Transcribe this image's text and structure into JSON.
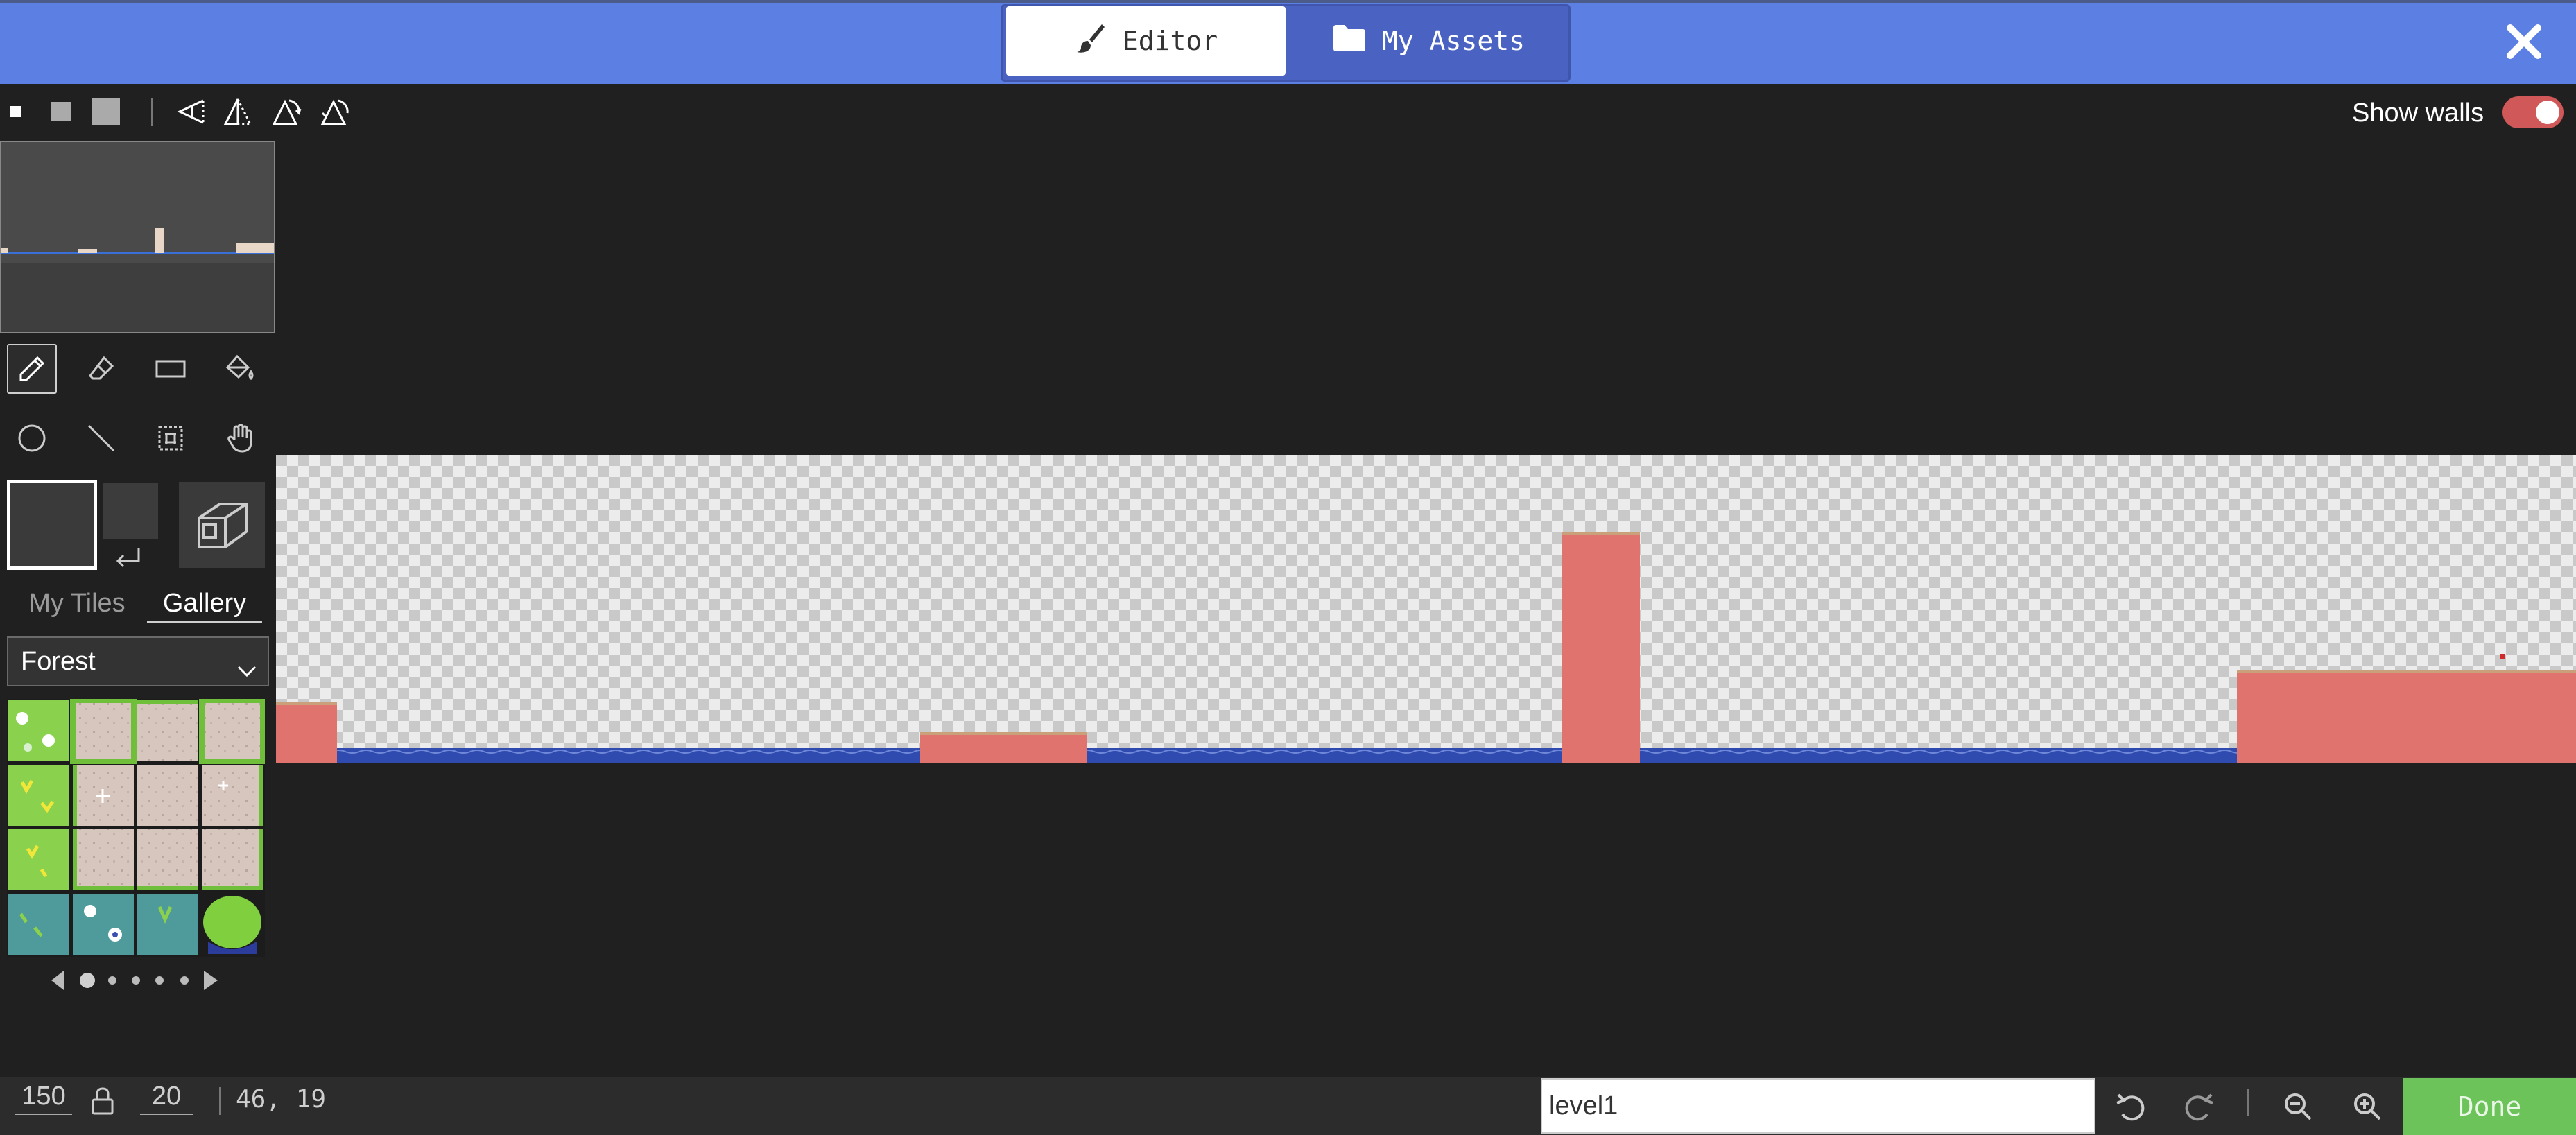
{
  "header": {
    "tabs": [
      {
        "label": "Editor",
        "icon": "paintbrush-icon",
        "active": true
      },
      {
        "label": "My Assets",
        "icon": "folder-icon",
        "active": false
      }
    ],
    "close_icon": "close-icon"
  },
  "toolbar": {
    "brush_sizes": [
      "small",
      "medium",
      "large"
    ],
    "transform_icons": [
      "rotate-flip-icon",
      "flip-vertical-icon",
      "rotate-icon",
      "rotate-alt-icon"
    ],
    "show_walls_label": "Show walls",
    "show_walls_on": true
  },
  "tools": {
    "row1": [
      "pencil-icon",
      "eraser-icon",
      "rectangle-icon",
      "fill-bucket-icon"
    ],
    "row2": [
      "circle-icon",
      "line-icon",
      "marquee-select-icon",
      "pan-hand-icon"
    ],
    "active": "pencil-icon"
  },
  "library": {
    "tabs": [
      "My Tiles",
      "Gallery"
    ],
    "active_tab": "Gallery",
    "selected_category": "Forest"
  },
  "bottom_bar": {
    "width": "150",
    "height": "20",
    "cursor": "46, 19",
    "level_name": "level1",
    "done_label": "Done"
  },
  "colors": {
    "header": "#5b7fe2",
    "background": "#202020",
    "wall": "#e0736d",
    "water": "#2f4bb0",
    "done": "#6bc35a",
    "toggle": "#d05858"
  }
}
